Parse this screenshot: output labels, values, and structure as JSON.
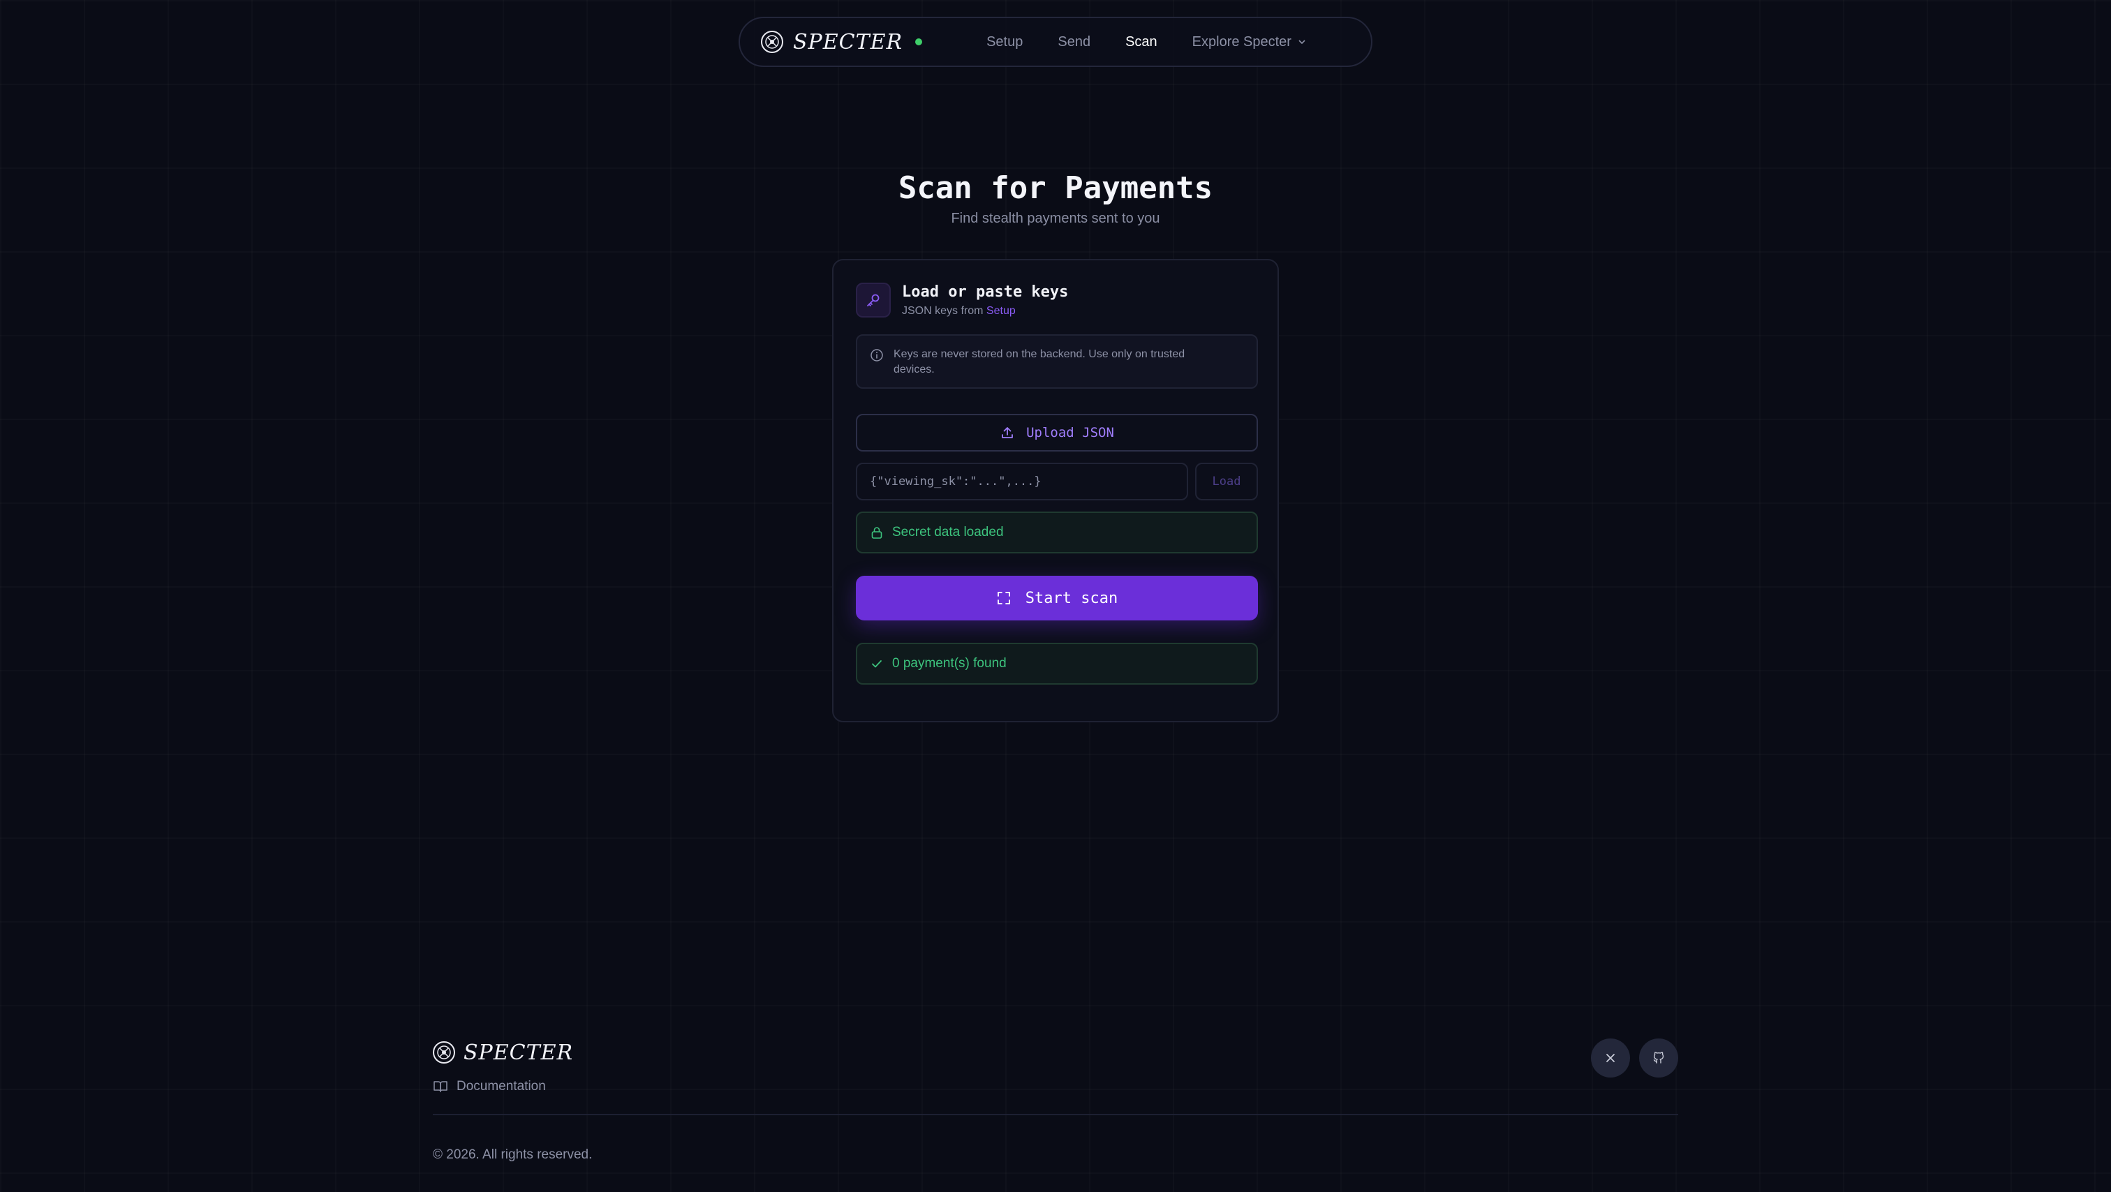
{
  "nav": {
    "brand": "SPECTER",
    "links": [
      {
        "label": "Setup",
        "active": false
      },
      {
        "label": "Send",
        "active": false
      },
      {
        "label": "Scan",
        "active": true
      },
      {
        "label": "Explore Specter",
        "active": false
      }
    ]
  },
  "header": {
    "title": "Scan for Payments",
    "subtitle": "Find stealth payments sent to you"
  },
  "card": {
    "title": "Load or paste keys",
    "subtitle_prefix": "JSON keys from",
    "subtitle_link": "Setup",
    "notice": "Keys are never stored on the backend. Use only on trusted devices.",
    "upload_label": "Upload JSON",
    "json_placeholder": "{\"viewing_sk\":\"...\",...}",
    "load_label": "Load",
    "secret_status": "Secret data loaded",
    "start_label": "Start scan",
    "result_status": "0 payment(s) found"
  },
  "footer": {
    "brand": "SPECTER",
    "documentation": "Documentation",
    "copyright": "© 2026. All rights reserved."
  },
  "icons": {
    "logo": "specter-logo-icon",
    "key": "key-icon",
    "info": "info-icon",
    "upload": "upload-icon",
    "lock": "lock-icon",
    "scan": "scan-frame-icon",
    "check": "check-icon",
    "book": "book-icon",
    "x": "x-social-icon",
    "github": "github-icon"
  },
  "colors": {
    "background": "#0a0c16",
    "accent": "#6b2fd9",
    "success": "#3dc47e",
    "status_dot": "#3fcf6a"
  }
}
